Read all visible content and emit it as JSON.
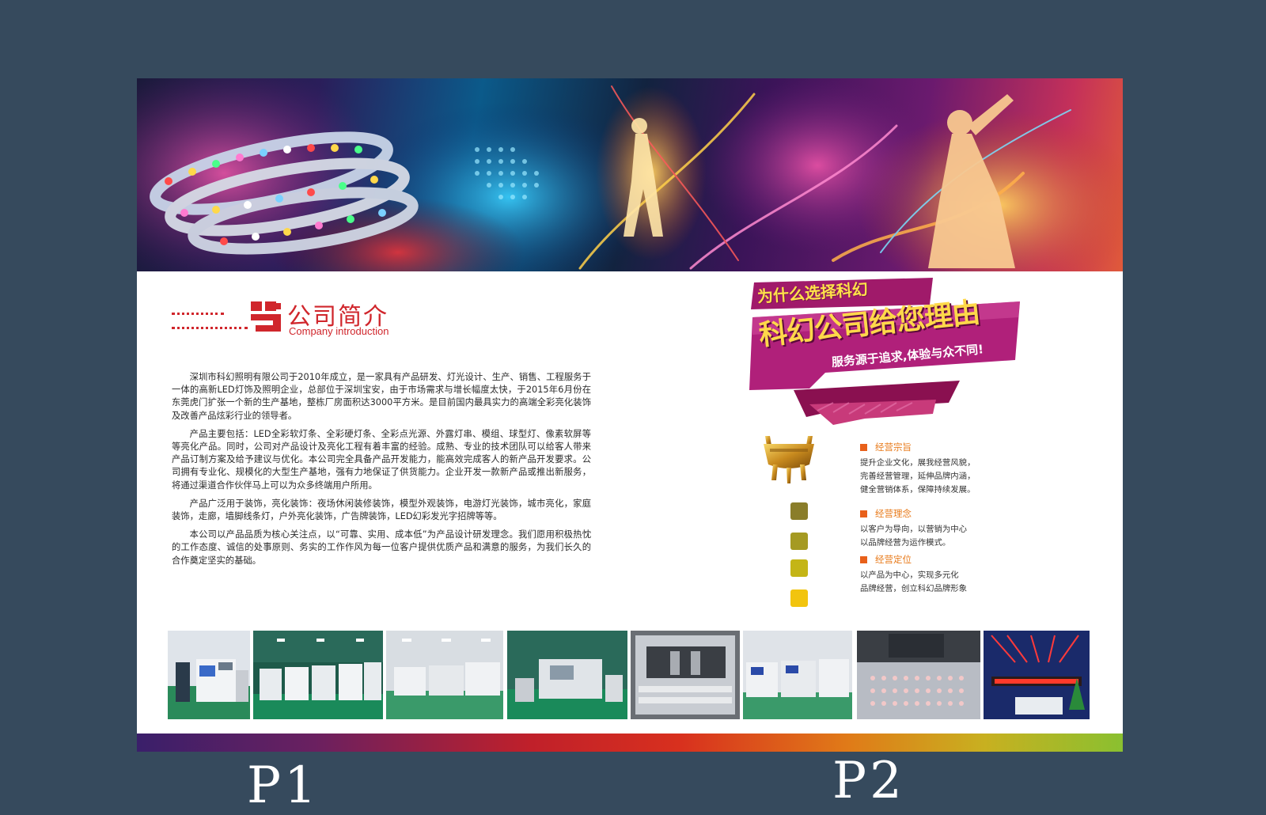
{
  "heading": {
    "title_cn": "公司简介",
    "title_en": "Company introduction"
  },
  "intro": {
    "paragraphs": [
      "深圳市科幻照明有限公司于2010年成立，是一家具有产品研发、灯光设计、生产、销售、工程服务于一体的高新LED灯饰及照明企业，总部位于深圳宝安，由于市场需求与增长幅度太快，于2015年6月份在东莞虎门扩张一个新的生产基地，整栋厂房面积达3000平方米。是目前国内最具实力的高端全彩亮化装饰及改善产品炫彩行业的领导者。",
      "产品主要包括：LED全彩软灯条、全彩硬灯条、全彩点光源、外露灯串、模组、球型灯、像素软屏等等亮化产品。同时，公司对产品设计及亮化工程有着丰富的经验。成熟、专业的技术团队可以给客人带来产品订制方案及给予建议与优化。本公司完全具备产品开发能力，能高效完成客人的新产品开发要求。公司拥有专业化、规模化的大型生产基地，强有力地保证了供货能力。企业开发一款新产品或推出新服务，将通过渠道合作伙伴马上可以为众多终端用户所用。",
      "产品广泛用于装饰，亮化装饰：夜场休闲装修装饰，模型外观装饰，电游灯光装饰，城市亮化，家庭装饰，走廊，墙脚线条灯，户外亮化装饰，广告牌装饰，LED幻彩发光字招牌等等。",
      "本公司以产品品质为核心关注点，以“可靠、实用、成本低”为产品设计研发理念。我们愿用积极热忱的工作态度、诚信的处事原则、务实的工作作风为每一位客户提供优质产品和满意的服务，为我们长久的合作奠定坚实的基础。"
    ]
  },
  "promo": {
    "tag": "为什么选择科幻",
    "headline": "科幻公司给您理由",
    "slogan": "服务源于追求,体验与众不同!"
  },
  "business": [
    {
      "title": "经营宗旨",
      "lines": [
        "提升企业文化，展我经营风貌，",
        "完善经营管理，延伸品牌内涵，",
        "健全营销体系，保障持续发展。"
      ]
    },
    {
      "title": "经营理念",
      "lines": [
        "以客户为导向，以营销为中心",
        "以品牌经营为运作模式。"
      ]
    },
    {
      "title": "经营定位",
      "lines": [
        "以产品为中心，实现多元化",
        "品牌经营，创立科幻品牌形象"
      ]
    }
  ],
  "square_colors": [
    "#8a7d2a",
    "#a59a22",
    "#c4b516",
    "#f2c40e"
  ],
  "accent_colors": {
    "brand_red": "#d0262c",
    "bullet_orange": "#e8601a",
    "background": "#364a5d"
  },
  "icons": [
    "company-logo-icon",
    "bronze-tripod-image"
  ],
  "page_labels": {
    "left": "P1",
    "right": "P2"
  }
}
